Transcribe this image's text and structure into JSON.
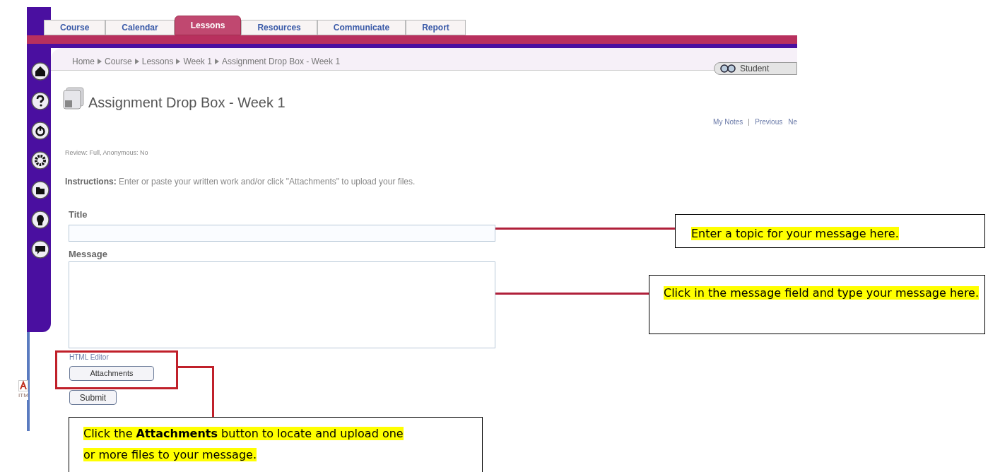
{
  "tabs": [
    {
      "label": "Course",
      "selected": false
    },
    {
      "label": "Calendar",
      "selected": false
    },
    {
      "label": "Lessons",
      "selected": true
    },
    {
      "label": "Resources",
      "selected": false
    },
    {
      "label": "Communicate",
      "selected": false
    },
    {
      "label": "Report",
      "selected": false
    }
  ],
  "breadcrumb": [
    "Home",
    "Course",
    "Lessons",
    "Week 1",
    "Assignment Drop Box - Week 1"
  ],
  "student_view": "Student",
  "page_title": "Assignment Drop Box - Week 1",
  "page_links": [
    "My Notes",
    "Previous",
    "Ne"
  ],
  "review_info": "Review: Full, Anonymous: No",
  "instructions": "**Instructions:** Enter or paste your written work and/or click \"Attachments\" to upload your files.",
  "form": {
    "title_label": "Title",
    "message_label": "Message",
    "html_editor": "HTML Editor",
    "attachments_button": "Attachments",
    "submit_button": "Submit"
  },
  "logo_text": "ITM",
  "callouts": [
    {
      "kind": "title",
      "text": "Enter a topic for your message here."
    },
    {
      "kind": "message",
      "text": "Click in the message field and type your message here."
    },
    {
      "kind": "attachments",
      "text": "Click the **Attachments** button to locate and upload one or more files to your message."
    }
  ]
}
